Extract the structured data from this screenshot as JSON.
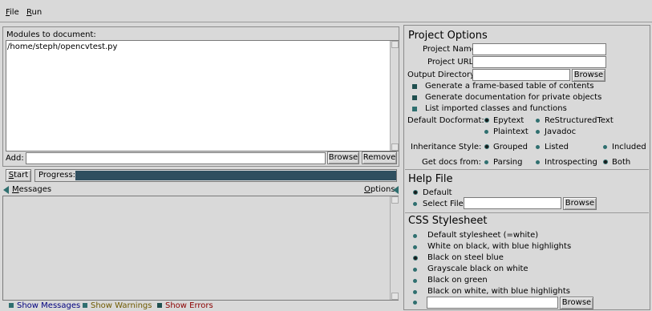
{
  "menu": {
    "file": "File",
    "file_key": "F",
    "file_rest": "ile",
    "run_key": "R",
    "run_rest": "un"
  },
  "modules": {
    "label": "Modules to document:",
    "items": [
      "/home/steph/opencvtest.py"
    ],
    "add_label": "Add:",
    "add_value": "",
    "browse": "Browse",
    "remove": "Remove"
  },
  "run": {
    "start_key": "S",
    "start_rest": "tart",
    "progress_label": "Progress:",
    "progress_value": 1.0,
    "progress_color": "#2f4f5f"
  },
  "messages": {
    "title_key": "M",
    "title_rest": "essages",
    "options_key": "O",
    "options_rest": "ptions",
    "show_messages": "Show Messages",
    "show_warnings": "Show Warnings",
    "show_errors": "Show Errors",
    "messages_color": "#00007f",
    "warnings_color": "#6f5a00",
    "errors_color": "#8b0000"
  },
  "project": {
    "title": "Project Options",
    "name_label": "Project Name:",
    "name_value": "",
    "url_label": "Project URL:",
    "url_value": "",
    "outdir_label": "Output Directory:",
    "outdir_value": "",
    "browse": "Browse",
    "checks": [
      {
        "label": "Generate a frame-based table of contents",
        "checked": true
      },
      {
        "label": "Generate documentation for private objects",
        "checked": true
      },
      {
        "label": "List imported classes and functions",
        "checked": false
      }
    ],
    "docformat_label": "Default Docformat:",
    "docformats": [
      "Epytext",
      "ReStructuredText",
      "Plaintext",
      "Javadoc"
    ],
    "docformat_selected": "Epytext",
    "inheritance_label": "Inheritance Style:",
    "inheritance": [
      "Grouped",
      "Listed",
      "Included"
    ],
    "inheritance_selected": "Grouped",
    "getdocs_label": "Get docs from:",
    "getdocs": [
      "Parsing",
      "Introspecting",
      "Both"
    ],
    "getdocs_selected": "Both"
  },
  "help": {
    "title": "Help File",
    "default": "Default",
    "select": "Select File",
    "select_value": "",
    "browse": "Browse"
  },
  "css": {
    "title": "CSS Stylesheet",
    "options": [
      "Default stylesheet (=white)",
      "White on black, with blue highlights",
      "Black on steel blue",
      "Grayscale black on white",
      "Black on green",
      "Black on white, with blue highlights"
    ],
    "selected": "Black on steel blue",
    "custom_value": "",
    "browse": "Browse"
  }
}
